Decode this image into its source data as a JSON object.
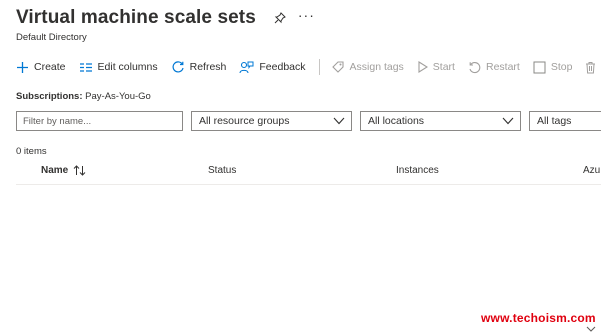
{
  "header": {
    "title": "Virtual machine scale sets",
    "subtitle": "Default Directory",
    "more_label": "···"
  },
  "toolbar": {
    "create": "Create",
    "edit_columns": "Edit columns",
    "refresh": "Refresh",
    "feedback": "Feedback",
    "assign_tags": "Assign tags",
    "start": "Start",
    "restart": "Restart",
    "stop": "Stop"
  },
  "subscriptions": {
    "label": "Subscriptions:",
    "value": "Pay-As-You-Go"
  },
  "filters": {
    "name_placeholder": "Filter by name...",
    "resource_groups": "All resource groups",
    "locations": "All locations",
    "tags": "All tags"
  },
  "results": {
    "count_text": "0 items"
  },
  "columns": [
    "Name",
    "Status",
    "Instances",
    "Azu"
  ],
  "watermark": "www.techoism.com",
  "colors": {
    "accent": "#0078d4",
    "disabled": "#a19f9d",
    "border": "#8a8886",
    "watermark": "#e0000f"
  }
}
